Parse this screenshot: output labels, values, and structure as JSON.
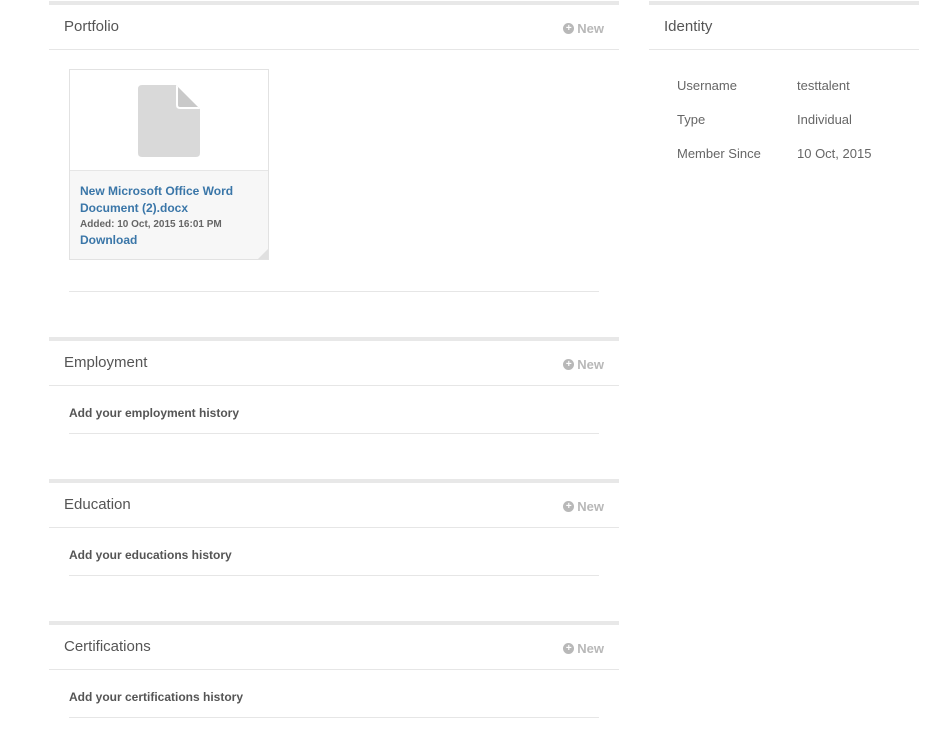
{
  "portfolio": {
    "title": "Portfolio",
    "new_label": "New",
    "file": {
      "name": "New Microsoft Office Word Document (2).docx",
      "added": "Added: 10 Oct, 2015 16:01 PM",
      "download_label": "Download"
    }
  },
  "employment": {
    "title": "Employment",
    "new_label": "New",
    "empty_text": "Add your employment history"
  },
  "education": {
    "title": "Education",
    "new_label": "New",
    "empty_text": "Add your educations history"
  },
  "certifications": {
    "title": "Certifications",
    "new_label": "New",
    "empty_text": "Add your certifications history"
  },
  "identity": {
    "title": "Identity",
    "rows": [
      {
        "label": "Username",
        "value": "testtalent"
      },
      {
        "label": "Type",
        "value": "Individual"
      },
      {
        "label": "Member Since",
        "value": "10 Oct, 2015"
      }
    ]
  },
  "icons": {
    "new": "plus-circle-icon",
    "file": "document-icon"
  }
}
